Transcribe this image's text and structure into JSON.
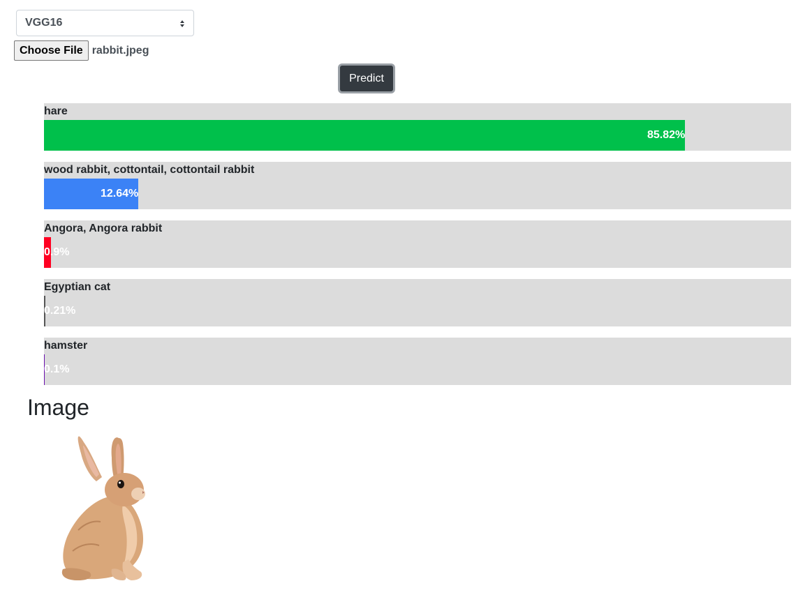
{
  "model_select": {
    "selected": "VGG16"
  },
  "file_input": {
    "button_label": "Choose File",
    "file_name": "rabbit.jpeg"
  },
  "predict_button": {
    "label": "Predict"
  },
  "predictions": [
    {
      "label": "hare",
      "value_text": "85.82%",
      "percent": 85.82,
      "color": "#00c04b"
    },
    {
      "label": "wood rabbit, cottontail, cottontail rabbit",
      "value_text": "12.64%",
      "percent": 12.64,
      "color": "#3b82f6"
    },
    {
      "label": "Angora, Angora rabbit",
      "value_text": "0.9%",
      "percent": 0.9,
      "color": "#ff0022"
    },
    {
      "label": "Egyptian cat",
      "value_text": "0.21%",
      "percent": 0.21,
      "color": "#555555"
    },
    {
      "label": "hamster",
      "value_text": "0.1%",
      "percent": 0.1,
      "color": "#6a0dad"
    }
  ],
  "image_section": {
    "heading": "Image",
    "image_subject": "rabbit-photo"
  }
}
